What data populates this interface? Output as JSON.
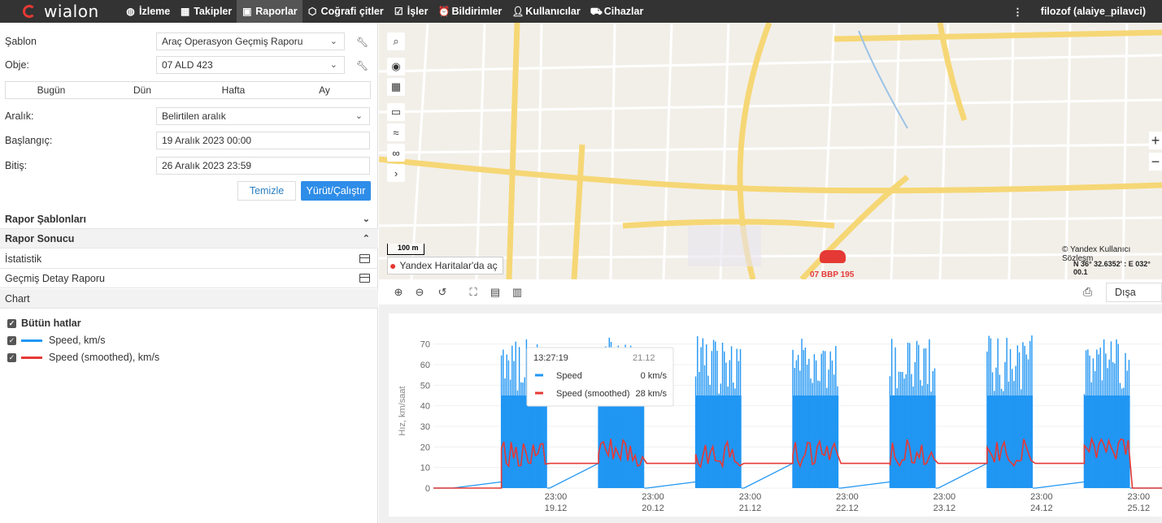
{
  "app": {
    "logo_text": "wialon"
  },
  "nav": {
    "items": [
      {
        "label": "İzleme",
        "icon": "globe-icon"
      },
      {
        "label": "Takipler",
        "icon": "track-icon"
      },
      {
        "label": "Raporlar",
        "icon": "report-icon",
        "active": true
      },
      {
        "label": "Coğrafi çitler",
        "icon": "geofence-icon"
      },
      {
        "label": "İşler",
        "icon": "tasks-icon"
      },
      {
        "label": "Bildirimler",
        "icon": "alarm-icon"
      },
      {
        "label": "Kullanıcılar",
        "icon": "user-icon"
      },
      {
        "label": "Cihazlar",
        "icon": "vehicle-icon"
      }
    ],
    "user": "filozof (alaiye_pilavci)"
  },
  "form": {
    "template_label": "Şablon",
    "template_value": "Araç Operasyon Geçmiş Raporu",
    "object_label": "Obje:",
    "object_value": "07 ALD 423",
    "quick": [
      "Bugün",
      "Dün",
      "Hafta",
      "Ay"
    ],
    "interval_label": "Aralık:",
    "interval_value": "Belirtilen aralık",
    "start_label": "Başlangıç:",
    "start_value": "19 Aralık 2023 00:00",
    "end_label": "Bitiş:",
    "end_value": "26 Aralık 2023 23:59",
    "clear_label": "Temizle",
    "run_label": "Yürüt/Çalıştır"
  },
  "sections": {
    "templates": "Rapor Şablonları",
    "result": "Rapor Sonucu",
    "stats": "İstatistik",
    "history": "Geçmiş Detay Raporu",
    "chart": "Chart"
  },
  "legend": {
    "all": "Bütün hatlar",
    "speed": "Speed, km/s",
    "speed_smoothed": "Speed (smoothed), km/s"
  },
  "map": {
    "scale_label": "100 m",
    "link_text": "Yandex Haritalar'da aç",
    "copyright": "© Yandex Kullanıcı Sözleşm",
    "coords": "N 36° 32.6352' : E 032° 00.1",
    "unit_label": "07 BBP 195",
    "zoom_in": "+",
    "zoom_out": "−"
  },
  "toolbar": {
    "export_label": "Dışa aktar"
  },
  "chart_data": {
    "type": "line",
    "ylabel": "Hız, km/saat",
    "ylim": [
      0,
      75
    ],
    "yticks": [
      0,
      10,
      20,
      30,
      40,
      50,
      60,
      70
    ],
    "xticks": [
      {
        "time": "23:00",
        "date": "19.12"
      },
      {
        "time": "23:00",
        "date": "20.12"
      },
      {
        "time": "23:00",
        "date": "21.12"
      },
      {
        "time": "23:00",
        "date": "22.12"
      },
      {
        "time": "23:00",
        "date": "23.12"
      },
      {
        "time": "23:00",
        "date": "24.12"
      },
      {
        "time": "23:00",
        "date": "25.12"
      }
    ],
    "series": [
      {
        "name": "Speed",
        "color": "#2196f3"
      },
      {
        "name": "Speed (smoothed)",
        "color": "#e53935"
      }
    ],
    "active_blocks_days": [
      {
        "start": 19.4,
        "end": 19.87
      },
      {
        "start": 20.4,
        "end": 20.87
      },
      {
        "start": 21.4,
        "end": 21.87
      },
      {
        "start": 22.4,
        "end": 22.87
      },
      {
        "start": 23.4,
        "end": 23.87
      },
      {
        "start": 24.4,
        "end": 24.87
      },
      {
        "start": 25.4,
        "end": 25.87
      }
    ],
    "speed_peak": 75,
    "smoothed_level_between": 12,
    "tooltip": {
      "time": "13:27:19",
      "date": "21.12",
      "rows": [
        {
          "name": "Speed",
          "value": "0 km/s"
        },
        {
          "name": "Speed (smoothed)",
          "value": "28 km/s"
        }
      ]
    }
  }
}
